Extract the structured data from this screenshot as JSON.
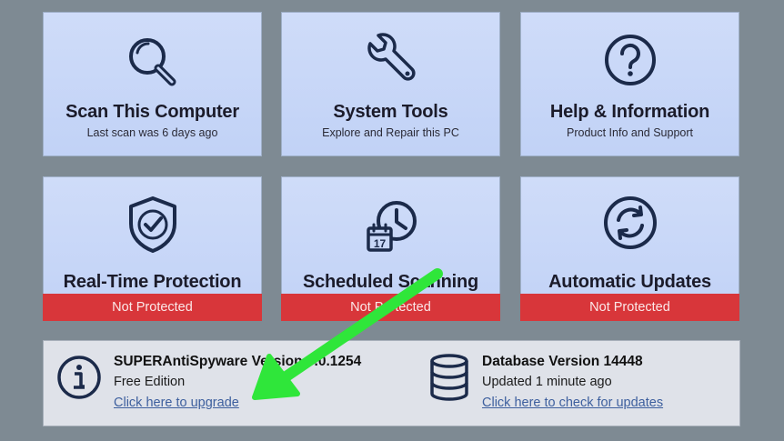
{
  "colors": {
    "background": "#7e8a93",
    "tile": "#c8d7f7",
    "icon": "#1b2a4a",
    "status_red": "#d8363a",
    "panel": "#dfe2e9",
    "link": "#3d5f9e",
    "annotation_arrow": "#2fe63a"
  },
  "tiles": [
    {
      "title": "Scan This Computer",
      "subtitle": "Last scan was 6 days ago",
      "icon": "magnifier-icon"
    },
    {
      "title": "System Tools",
      "subtitle": "Explore and Repair this PC",
      "icon": "wrench-icon"
    },
    {
      "title": "Help & Information",
      "subtitle": "Product Info and Support",
      "icon": "question-icon"
    },
    {
      "title": "Real-Time Protection",
      "status": "Not Protected",
      "icon": "shield-check-icon"
    },
    {
      "title": "Scheduled Scanning",
      "status": "Not Protected",
      "icon": "calendar-clock-icon",
      "calendar_day": "17"
    },
    {
      "title": "Automatic Updates",
      "status": "Not Protected",
      "icon": "refresh-icon"
    }
  ],
  "info": {
    "version": {
      "title": "SUPERAntiSpyware Version 6.0.1254",
      "edition": "Free Edition",
      "link": "Click here to upgrade",
      "icon": "info-icon"
    },
    "database": {
      "title": "Database Version 14448",
      "updated": "Updated 1 minute ago",
      "link": "Click here to check for updates",
      "icon": "database-icon"
    }
  }
}
